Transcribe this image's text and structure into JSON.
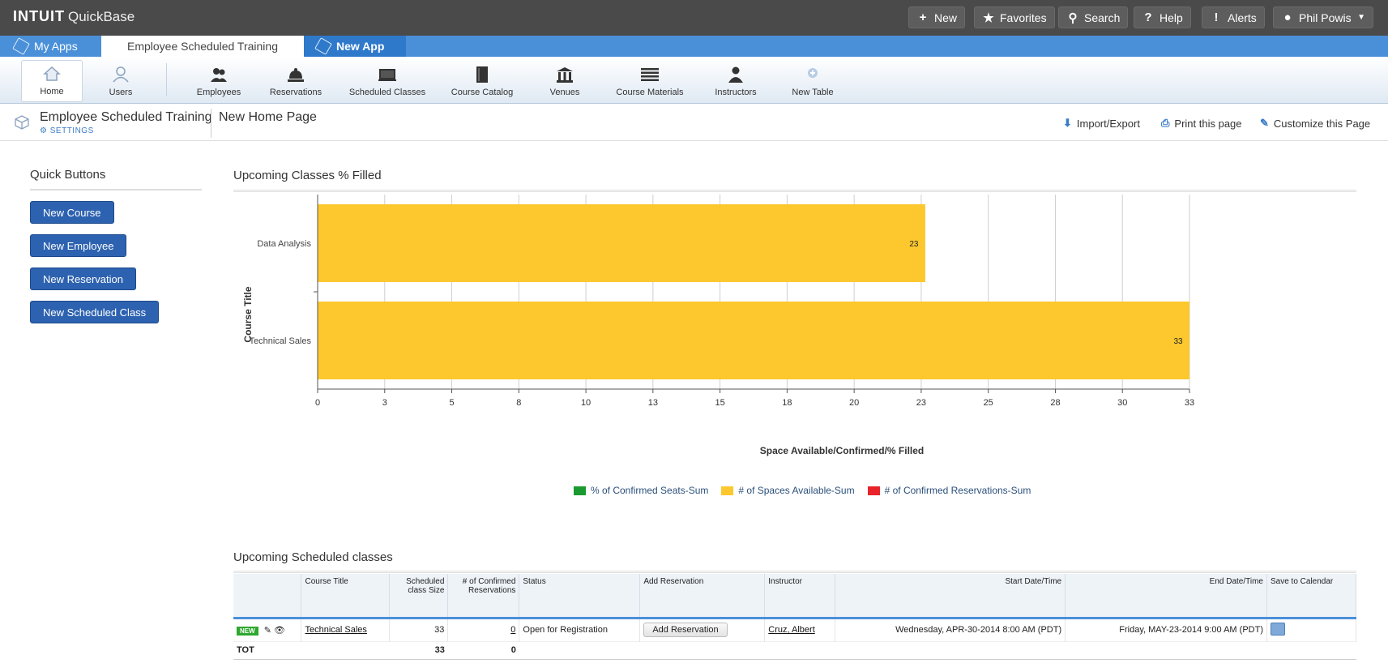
{
  "brand": {
    "name": "INTUIT",
    "product": "QuickBase"
  },
  "topbar": {
    "new": "New",
    "favorites": "Favorites",
    "search": "Search",
    "help": "Help",
    "alerts": "Alerts",
    "user": "Phil Powis"
  },
  "apptabs": {
    "my_apps": "My Apps",
    "current": "Employee Scheduled Training",
    "new_app": "New App"
  },
  "tables": [
    {
      "label": "Home",
      "icon": "home-icon"
    },
    {
      "label": "Users",
      "icon": "users-icon"
    },
    {
      "label": "Employees",
      "icon": "employees-icon"
    },
    {
      "label": "Reservations",
      "icon": "bell-icon"
    },
    {
      "label": "Scheduled Classes",
      "icon": "classes-icon"
    },
    {
      "label": "Course Catalog",
      "icon": "book-icon"
    },
    {
      "label": "Venues",
      "icon": "building-icon"
    },
    {
      "label": "Course Materials",
      "icon": "stack-icon"
    },
    {
      "label": "Instructors",
      "icon": "instructor-icon"
    },
    {
      "label": "New Table",
      "icon": "plus-icon"
    }
  ],
  "pageheader": {
    "app_title": "Employee Scheduled Training",
    "settings": "SETTINGS",
    "page_name": "New Home Page",
    "import_export": "Import/Export",
    "print": "Print this page",
    "customize": "Customize this Page"
  },
  "quick_buttons": {
    "title": "Quick Buttons",
    "buttons": [
      "New Course",
      "New Employee",
      "New Reservation",
      "New Scheduled Class"
    ]
  },
  "chart_section": {
    "title": "Upcoming Classes % Filled"
  },
  "chart_data": {
    "type": "bar",
    "orientation": "horizontal",
    "categories": [
      "Data Analysis",
      "Technical Sales"
    ],
    "series": [
      {
        "name": "# of Spaces Available-Sum",
        "color": "#fcc82e",
        "values": [
          23,
          33
        ]
      }
    ],
    "value_labels": [
      "23",
      "33"
    ],
    "xlabel": "Space Available/Confirmed/% Filled",
    "ylabel": "Course Title",
    "xlim": [
      0,
      33
    ],
    "xticks": [
      "0",
      "3",
      "5",
      "8",
      "10",
      "13",
      "15",
      "18",
      "20",
      "23",
      "25",
      "28",
      "30",
      "33"
    ],
    "grid": true,
    "legend": [
      {
        "name": "% of Confirmed Seats-Sum",
        "color": "#1a9a2e"
      },
      {
        "name": "# of Spaces Available-Sum",
        "color": "#fcc82e"
      },
      {
        "name": "# of Confirmed Reservations-Sum",
        "color": "#e8232a"
      }
    ],
    "legend_placement": "bottom"
  },
  "table_section": {
    "title": "Upcoming Scheduled classes",
    "columns": [
      "Course Title",
      "Scheduled class Size",
      "# of Confirmed Reservations",
      "Status",
      "Add Reservation",
      "Instructor",
      "Start Date/Time",
      "End Date/Time",
      "Save to Calendar"
    ],
    "row": {
      "badge": "NEW",
      "course_title": "Technical Sales",
      "size": "33",
      "confirmed": "0",
      "status": "Open for Registration",
      "add_reservation": "Add  Reservation",
      "instructor": "Cruz, Albert",
      "start": "Wednesday, APR-30-2014  8:00 AM (PDT)",
      "end": "Friday, MAY-23-2014  9:00 AM (PDT)"
    },
    "totals": {
      "label": "TOT",
      "size": "33",
      "confirmed": "0"
    }
  }
}
